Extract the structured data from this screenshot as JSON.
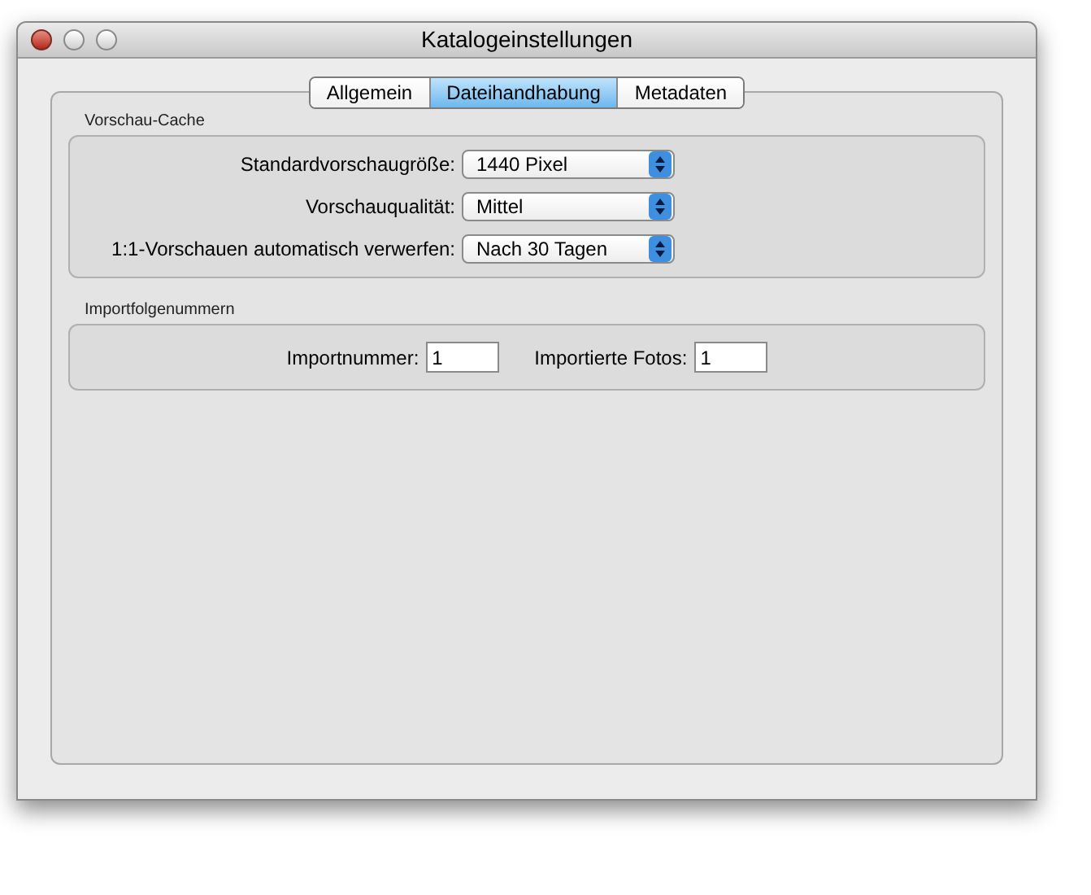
{
  "window": {
    "title": "Katalogeinstellungen"
  },
  "tabs": [
    {
      "label": "Allgemein",
      "selected": false
    },
    {
      "label": "Dateihandhabung",
      "selected": true
    },
    {
      "label": "Metadaten",
      "selected": false
    }
  ],
  "preview_cache": {
    "title": "Vorschau-Cache",
    "rows": [
      {
        "label": "Standardvorschaugröße:",
        "value": "1440 Pixel"
      },
      {
        "label": "Vorschauqualität:",
        "value": "Mittel"
      },
      {
        "label": "1:1-Vorschauen automatisch verwerfen:",
        "value": "Nach 30 Tagen"
      }
    ]
  },
  "import_numbers": {
    "title": "Importfolgenummern",
    "fields": [
      {
        "label": "Importnummer:",
        "value": "1"
      },
      {
        "label": "Importierte Fotos:",
        "value": "1"
      }
    ]
  }
}
